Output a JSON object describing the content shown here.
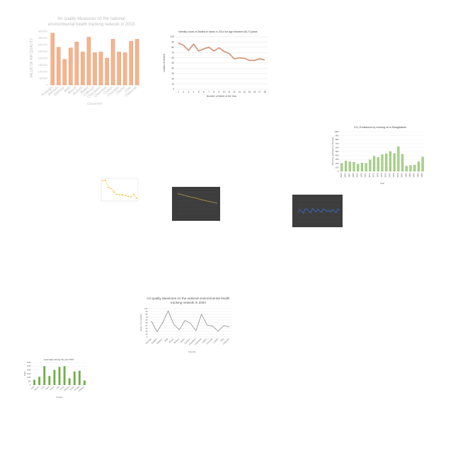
{
  "chart_data": [
    {
      "type": "bar",
      "title": "Air quality Measures on the national environmental health tracking network in 2013",
      "title_lines": [
        "Air quality Measures on the national",
        "environmental health tracking network in 2013"
      ],
      "xlabel": "COUNTRY",
      "ylabel": "VALUE OF AIR QUALITY",
      "ylim": [
        0,
        400000
      ],
      "yticks": [
        "0",
        "50000",
        "100000",
        "150000",
        "200000",
        "250000",
        "300000",
        "350000",
        "400000"
      ],
      "categories": [
        "Autauga",
        "Baldwin",
        "Barbour",
        "Bibb",
        "Blount",
        "Bullock",
        "Butler",
        "Calhoun",
        "Chambers",
        "Cherokee",
        "Chilton",
        "Choctaw",
        "Clarke",
        "Clay",
        "Cleburne"
      ],
      "values": [
        385000,
        280000,
        190000,
        275000,
        320000,
        245000,
        355000,
        240000,
        245000,
        200000,
        340000,
        245000,
        240000,
        325000,
        340000
      ],
      "colors": {
        "bar": "#f3b48e",
        "bar_stroke": "#e48a5a",
        "text": "#bfbfbf"
      }
    },
    {
      "type": "line",
      "title": "Weekly count of Deaths in Idaho in 2014 for age between 65-74 years",
      "xlabel": "Number of Week of the Year",
      "ylabel": "number of deaths",
      "ylim": [
        0,
        100
      ],
      "yticks": [
        "0",
        "10",
        "20",
        "30",
        "40",
        "50",
        "60",
        "70",
        "80",
        "90",
        "100"
      ],
      "x": [
        1,
        2,
        3,
        4,
        5,
        6,
        7,
        8,
        9,
        10,
        11,
        12,
        13,
        14,
        15,
        16,
        17,
        18
      ],
      "values": [
        88,
        84,
        74,
        86,
        73,
        77,
        80,
        73,
        79,
        72,
        68,
        58,
        60,
        59,
        55,
        55,
        58,
        56
      ],
      "colors": {
        "line": "#d29a7e",
        "grid": "#d9d9d9"
      }
    },
    {
      "type": "bar",
      "title": "CO₂ Emissions by burning oil in Bangladesh",
      "xlabel": "Year",
      "ylabel": "Total CO₂ Emissions (Tonnes)",
      "ylim": [
        0,
        1000
      ],
      "yticks": [
        "0",
        "100",
        "200",
        "300",
        "400",
        "500",
        "600",
        "700",
        "800",
        "900",
        "1000"
      ],
      "categories": [
        "1965",
        "1966",
        "1967",
        "1968",
        "1969",
        "1970",
        "1971",
        "1972",
        "1973",
        "1974",
        "1975",
        "1976",
        "1977",
        "1978",
        "1979",
        "1980",
        "1981",
        "1982",
        "1983",
        "1984",
        "1985"
      ],
      "values": [
        200,
        260,
        240,
        230,
        180,
        210,
        200,
        290,
        380,
        350,
        420,
        440,
        500,
        450,
        620,
        430,
        130,
        150,
        160,
        240,
        360
      ],
      "colors": {
        "bar": "#a9d18e",
        "bar_stroke": "#70ad47"
      }
    },
    {
      "type": "line",
      "title": "",
      "values": [
        90,
        92,
        60,
        55,
        40,
        30,
        28,
        27,
        25,
        20,
        18,
        30,
        12
      ],
      "ylim": [
        0,
        100
      ],
      "colors": {
        "line": "#f4c542",
        "marker": "#e0a800"
      }
    },
    {
      "type": "line",
      "title": "",
      "values": [
        95,
        92,
        90,
        88,
        85,
        82,
        80,
        77,
        75,
        73,
        70,
        68,
        65,
        63,
        60,
        58,
        56,
        54,
        52,
        50
      ],
      "ylim": [
        0,
        100
      ],
      "colors": {
        "background": "#3d3d3d",
        "line": "#f2c14e"
      }
    },
    {
      "type": "line",
      "title": "",
      "values": [
        45,
        55,
        50,
        40,
        60,
        58,
        48,
        42,
        62,
        52,
        46,
        58,
        50,
        44,
        60,
        55,
        48,
        52,
        45,
        56,
        50,
        42,
        58,
        54
      ],
      "ylim": [
        0,
        100
      ],
      "colors": {
        "background": "#3d3d3d",
        "line": "#3a6fd8"
      }
    },
    {
      "type": "line",
      "title": "Air quality Measures on the national environmental health tracking network in 2004",
      "title_lines": [
        "Air quality Measures on the national environmental health",
        "tracking network in 2004"
      ],
      "xlabel": "Country",
      "ylabel": "Value of air quality",
      "ylim": [
        0,
        100
      ],
      "yticks": [
        "0",
        "10",
        "20",
        "30",
        "40",
        "50",
        "60",
        "70",
        "80",
        "90",
        "100"
      ],
      "categories": [
        "Autauga",
        "Baldwin",
        "Barbour",
        "Bibb",
        "Blount",
        "Bullock",
        "Butler",
        "Calhoun",
        "Chambers",
        "Cherokee",
        "Chilton",
        "Choctaw",
        "Clarke",
        "Clay",
        "Cleburne",
        "Coffee",
        "Colbert",
        "Conecuh",
        "Coosa",
        "Covington",
        "Crenshaw"
      ],
      "values": [
        55,
        18,
        50,
        92,
        45,
        25,
        58,
        48,
        22,
        80,
        42,
        38,
        20,
        40,
        35
      ],
      "colors": {
        "line": "#8c8c8c",
        "grid": "#e0e0e0"
      }
    },
    {
      "type": "bar",
      "title": "Land sales during the year 1997",
      "xlabel": "Country",
      "ylabel": "Sales",
      "ylim": [
        0,
        3000
      ],
      "yticks": [
        "0",
        "500",
        "1000",
        "1500",
        "2000",
        "2500",
        "3000"
      ],
      "categories": [
        "Cuba",
        "Bahrain",
        "Chile",
        "Egypt",
        "Greece",
        "India",
        "Kenya",
        "Malaysia",
        "Norway",
        "Portugal",
        "Singapore"
      ],
      "values": [
        700,
        1100,
        2500,
        1200,
        2000,
        2400,
        2500,
        900,
        1800,
        1900,
        600
      ],
      "colors": {
        "bar": "#70ad47",
        "grid": "#e6e6e6"
      }
    }
  ]
}
